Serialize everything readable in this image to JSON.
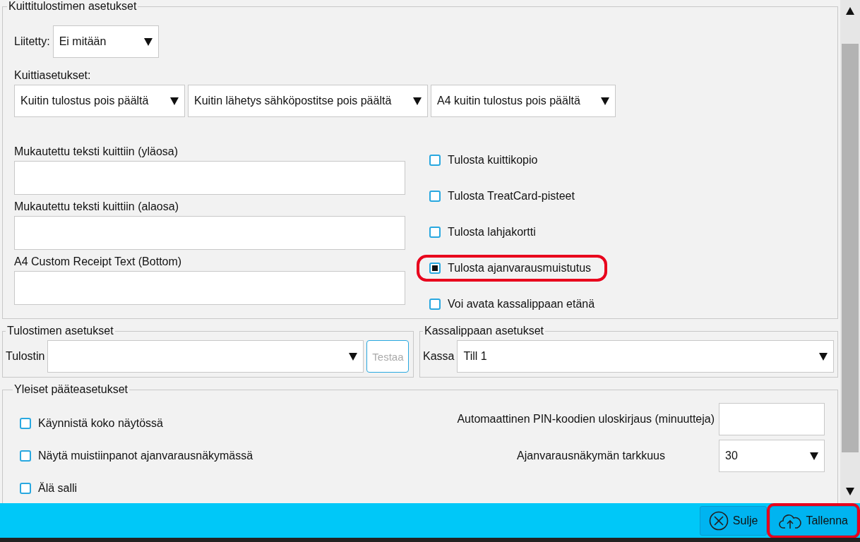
{
  "receipt_printer": {
    "legend": "Kuittitulostimen asetukset",
    "connected": {
      "label": "Liitetty:",
      "value": "Ei mitään"
    },
    "receipt_settings_label": "Kuittiasetukset:",
    "receipt_selects": [
      {
        "value": "Kuitin tulostus pois päältä"
      },
      {
        "value": "Kuitin lähetys sähköpostitse pois päältä"
      },
      {
        "value": "A4 kuitin tulostus pois päältä"
      }
    ],
    "text_fields": [
      {
        "label": "Mukautettu teksti kuittiin (yläosa)"
      },
      {
        "label": "Mukautettu teksti kuittiin (alaosa)"
      },
      {
        "label": "A4 Custom Receipt Text (Bottom)"
      }
    ],
    "options": [
      {
        "label": "Tulosta kuittikopio",
        "checked": false,
        "highlighted": false
      },
      {
        "label": "Tulosta TreatCard-pisteet",
        "checked": false,
        "highlighted": false
      },
      {
        "label": "Tulosta lahjakortti",
        "checked": false,
        "highlighted": false
      },
      {
        "label": "Tulosta ajanvarausmuistutus",
        "checked": true,
        "highlighted": true
      },
      {
        "label": "Voi avata kassalippaan etänä",
        "checked": false,
        "highlighted": false
      }
    ]
  },
  "printer": {
    "legend": "Tulostimen asetukset",
    "label": "Tulostin",
    "test_button": {
      "label": "Testaa",
      "disabled": true
    }
  },
  "cash_drawer": {
    "legend": "Kassalippaan asetukset",
    "label": "Kassa",
    "value": "Till 1"
  },
  "general": {
    "legend": "Yleiset pääteasetukset",
    "options": [
      {
        "label": "Käynnistä koko näytössä",
        "checked": false
      },
      {
        "label": "Näytä muistiinpanot ajanvarausnäkymässä",
        "checked": false
      },
      {
        "label": "Älä salli",
        "checked": false
      }
    ],
    "auto_logout": {
      "label": "Automaattinen PIN-koodien uloskirjaus (minuutteja)"
    },
    "precision": {
      "label": "Ajanvarausnäkymän tarkkuus",
      "value": "30"
    }
  },
  "footer": {
    "buttons": [
      {
        "kind": "close",
        "label": "Sulje",
        "highlighted": false
      },
      {
        "kind": "save",
        "label": "Tallenna",
        "highlighted": true
      }
    ]
  }
}
